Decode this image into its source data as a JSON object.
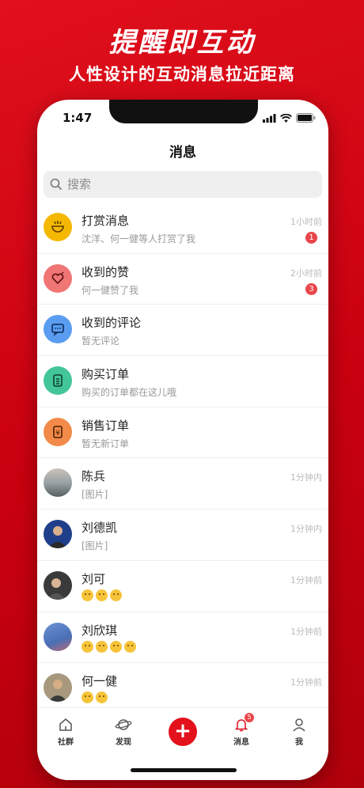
{
  "promo": {
    "title": "提醒即互动",
    "subtitle": "人性设计的互动消息拉近距离"
  },
  "status_bar": {
    "time": "1:47"
  },
  "nav": {
    "title": "消息"
  },
  "search": {
    "placeholder": "搜索"
  },
  "messages": [
    {
      "name": "打赏消息",
      "preview": "沈洋、何一健等人打赏了我",
      "time": "1小时前",
      "badge": "1",
      "icon": "reward-icon",
      "color": "#f5b800"
    },
    {
      "name": "收到的赞",
      "preview": "何一健赞了我",
      "time": "2小时前",
      "badge": "3",
      "icon": "heart-icon",
      "color": "#f07575"
    },
    {
      "name": "收到的评论",
      "preview": "暂无评论",
      "icon": "comment-icon",
      "color": "#5a9cf0"
    },
    {
      "name": "购买订单",
      "preview": "购买的订单都在这儿哦",
      "icon": "clipboard-icon",
      "color": "#43c59a"
    },
    {
      "name": "销售订单",
      "preview": "暂无新订单",
      "icon": "yen-receipt-icon",
      "color": "#f28a4a"
    },
    {
      "name": "陈兵",
      "preview": "[图片]",
      "time": "1分钟内",
      "icon": "avatar-landscape",
      "color": "#9aa3a8"
    },
    {
      "name": "刘德凯",
      "preview": "[图片]",
      "time": "1分钟内",
      "icon": "avatar-portrait",
      "color": "#1f3f8a"
    },
    {
      "name": "刘可",
      "time": "1分钟前",
      "emojis": 3,
      "icon": "avatar-portrait",
      "color": "#3a3a3a"
    },
    {
      "name": "刘欣琪",
      "time": "1分钟前",
      "emojis": 4,
      "icon": "avatar-portrait",
      "color": "#4a6fb5"
    },
    {
      "name": "何一健",
      "time": "1分钟前",
      "emojis": 2,
      "icon": "avatar-portrait",
      "color": "#8a6a4a"
    }
  ],
  "tabs": [
    {
      "label": "社群",
      "icon": "home-icon"
    },
    {
      "label": "发现",
      "icon": "planet-icon"
    },
    {
      "label": "",
      "icon": "plus-icon"
    },
    {
      "label": "消息",
      "icon": "bell-icon",
      "badge": "5"
    },
    {
      "label": "我",
      "icon": "user-icon"
    }
  ],
  "colors": {
    "brand_red": "#e3111c",
    "badge_red": "#e8464a"
  }
}
